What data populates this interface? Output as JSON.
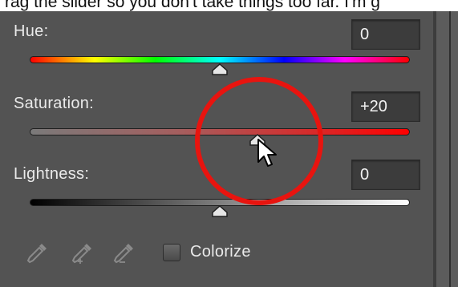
{
  "caption": {
    "text": "rag the slider so you don't take things too far. I'm g"
  },
  "hue": {
    "label": "Hue:",
    "value": "0",
    "slider_position": 0.5
  },
  "saturation": {
    "label": "Saturation:",
    "value": "+20",
    "slider_position": 0.6
  },
  "lightness": {
    "label": "Lightness:",
    "value": "0",
    "slider_position": 0.5
  },
  "tools": [
    {
      "icon": "eyedropper-icon"
    },
    {
      "icon": "eyedropper-add-icon"
    },
    {
      "icon": "eyedropper-subtract-icon"
    }
  ],
  "colorize": {
    "label": "Colorize",
    "checked": false
  },
  "colors": {
    "panel": "#535353",
    "annotation": "#e8140f",
    "label_text": "#eaeaea"
  }
}
